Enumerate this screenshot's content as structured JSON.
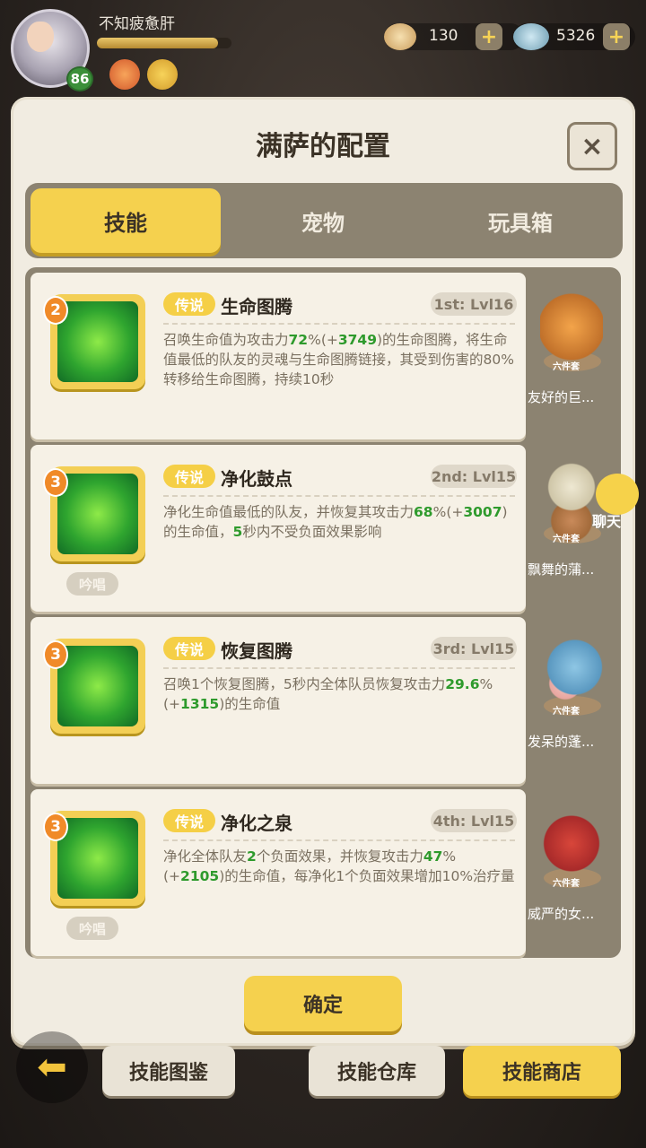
{
  "player": {
    "name": "不知疲惫肝",
    "level": "86",
    "exp_fraction": 0.9
  },
  "currency": [
    {
      "icon": "shell-icon",
      "value": "130"
    },
    {
      "icon": "gem-icon",
      "value": "5326"
    }
  ],
  "panel": {
    "title": "满萨的配置",
    "tabs": [
      "技能",
      "宠物",
      "玩具箱"
    ],
    "active_tab": "技能",
    "skills": [
      {
        "stars": "2",
        "tag": "传说",
        "name": "生命图腾",
        "slot": "1st: Lvl16",
        "desc_a": "召唤生命值为攻击力",
        "val1": "72",
        "desc_b": "%(+",
        "val2": "3749",
        "desc_c": ")的生命图腾，将生命值最低的队友的灵魂与生命图腾链接，其受到伤害的80%转移给生命图腾，持续10秒",
        "chant": "",
        "pet_name": "友好的巨...",
        "pet_badge": "六件套"
      },
      {
        "stars": "3",
        "tag": "传说",
        "name": "净化鼓点",
        "slot": "2nd: Lvl15",
        "desc_a": "净化生命值最低的队友，并恢复其攻击力",
        "val1": "68",
        "desc_b": "%(+",
        "val2": "3007",
        "desc_c": ")的生命值，",
        "val3": "5",
        "desc_d": "秒内不受负面效果影响",
        "chant": "吟唱",
        "pet_name": "飘舞的蒲...",
        "pet_badge": "六件套"
      },
      {
        "stars": "3",
        "tag": "传说",
        "name": "恢复图腾",
        "slot": "3rd: Lvl15",
        "desc_a": "召唤1个恢复图腾，5秒内全体队员恢复攻击力",
        "val1": "29.6",
        "desc_b": "%(+",
        "val2": "1315",
        "desc_c": ")的生命值",
        "chant": "",
        "pet_name": "发呆的蓬...",
        "pet_badge": "六件套"
      },
      {
        "stars": "3",
        "tag": "传说",
        "name": "净化之泉",
        "slot": "4th: Lvl15",
        "desc_a": "净化全体队友",
        "val1": "2",
        "desc_b": "个负面效果，并恢复攻击力",
        "val2": "47",
        "desc_c": "%(+",
        "val3": "2105",
        "desc_d": ")的生命值，每净化1个负面效果增加10%治疗量",
        "chant": "吟唱",
        "pet_name": "威严的女...",
        "pet_badge": "六件套"
      }
    ],
    "confirm": "确定"
  },
  "chat": {
    "label": "聊天"
  },
  "bottom": {
    "buttons": [
      "技能图鉴",
      "技能仓库",
      "技能商店"
    ]
  },
  "colors": {
    "accent": "#f5d14e",
    "highlight": "#2e9a2c",
    "panel": "#f1ece1"
  }
}
